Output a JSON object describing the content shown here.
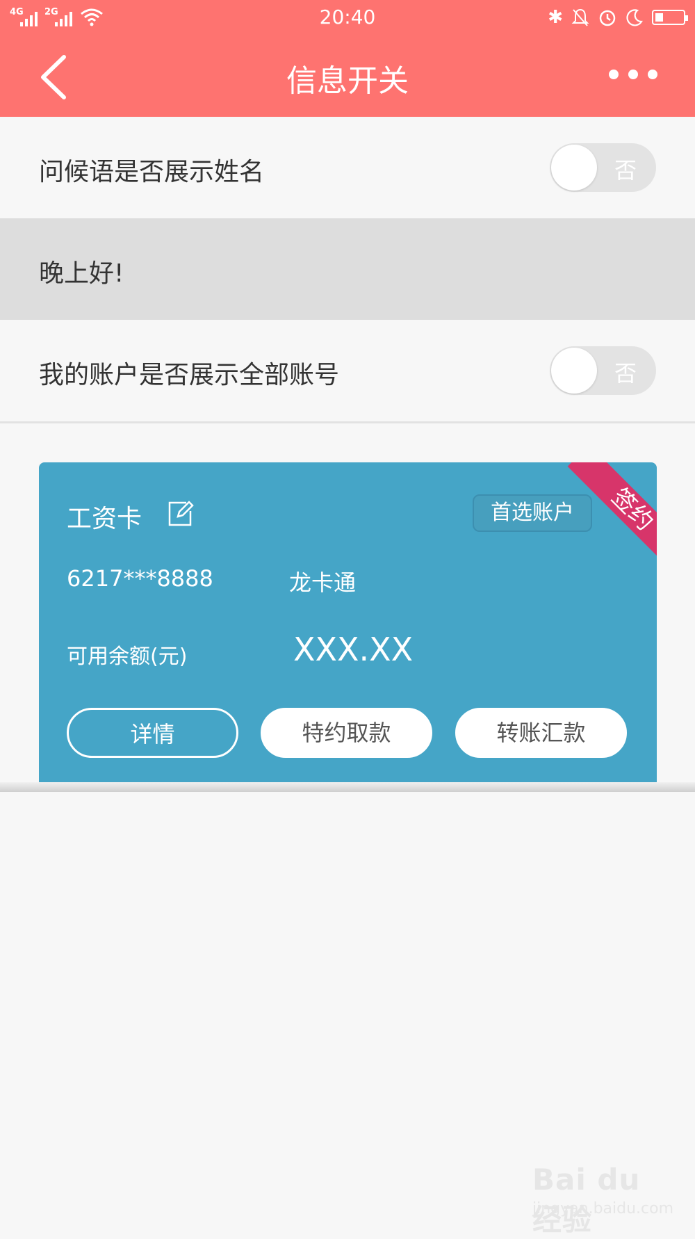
{
  "status_bar": {
    "network_1": "4G",
    "network_2": "2G",
    "time": "20:40",
    "icons": [
      "wifi-icon",
      "bluetooth-icon",
      "bell-off-icon",
      "alarm-icon",
      "moon-icon",
      "battery-icon"
    ],
    "battery_level": 0.2
  },
  "nav": {
    "title": "信息开关",
    "back_icon": "chevron-left-icon",
    "more_icon": "more-dots-icon"
  },
  "settings": [
    {
      "label": "问候语是否展示姓名",
      "toggle": "否",
      "on": false
    },
    {
      "label": "我的账户是否展示全部账号",
      "toggle": "否",
      "on": false
    }
  ],
  "greeting": "晚上好!",
  "card": {
    "name": "工资卡",
    "edit_icon": "edit-icon",
    "preferred_label": "首选账户",
    "ribbon": "签约",
    "account_number": "6217***8888",
    "card_type": "龙卡通",
    "balance_label": "可用余额(元)",
    "balance": "XXX.XX",
    "buttons": [
      "详情",
      "特约取款",
      "转账汇款"
    ]
  },
  "colors": {
    "header": "#fe7370",
    "card": "#45a5c7",
    "ribbon": "#d7356a",
    "toggle_off": "#e3e3e3"
  },
  "watermark": {
    "line1": "Bai du 经验",
    "line2": "jingyan.baidu.com"
  }
}
